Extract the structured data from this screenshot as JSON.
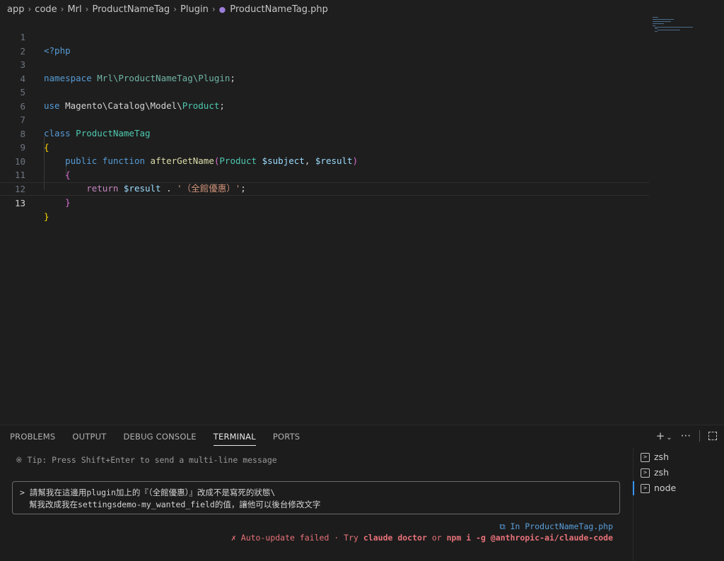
{
  "breadcrumb": {
    "items": [
      "app",
      "code",
      "Mrl",
      "ProductNameTag",
      "Plugin"
    ],
    "file": "ProductNameTag.php"
  },
  "editor": {
    "line_numbers": [
      "1",
      "2",
      "3",
      "4",
      "5",
      "6",
      "7",
      "8",
      "9",
      "10",
      "11",
      "12",
      "13"
    ],
    "code": {
      "l1": "<?php",
      "l3_kw": "namespace",
      "l3_ns": "Mrl\\ProductNameTag\\Plugin",
      "l3_end": ";",
      "l5_kw": "use",
      "l5_ns": "Magento\\Catalog\\Model\\",
      "l5_cls": "Product",
      "l5_end": ";",
      "l7_kw": "class",
      "l7_cls": "ProductNameTag",
      "open_brace": "{",
      "l9_kw1": "public",
      "l9_kw2": "function",
      "l9_fn": "afterGetName",
      "l9_p1": "(",
      "l9_cls": "Product",
      "l9_v1": "$subject",
      "l9_comma": ", ",
      "l9_v2": "$result",
      "l9_p2": ")",
      "l11_kw": "return",
      "l11_var": "$result",
      "l11_op": " . ",
      "l11_str": "'（全館優惠）'",
      "l11_end": ";",
      "close_brace": "}"
    }
  },
  "panel": {
    "tabs": [
      "PROBLEMS",
      "OUTPUT",
      "DEBUG CONSOLE",
      "TERMINAL",
      "PORTS"
    ],
    "active_tab": "TERMINAL"
  },
  "terminal": {
    "tip": "※ Tip: Press Shift+Enter to send a multi-line message",
    "input_line1": "> 請幫我在這邊用plugin加上的『（全館優惠）』改成不是寫死的狀態\\",
    "input_line2": "幫我改成我在settingsdemo-my_wanted_field的值，讓他可以後台修改文字",
    "status_file": "⧉ In ProductNameTag.php",
    "error_prefix": "✗ Auto-update failed · Try ",
    "error_cmd1": "claude doctor",
    "error_mid": " or ",
    "error_cmd2": "npm i -g @anthropic-ai/claude-code"
  },
  "terminal_list": {
    "items": [
      "zsh",
      "zsh",
      "node"
    ]
  }
}
